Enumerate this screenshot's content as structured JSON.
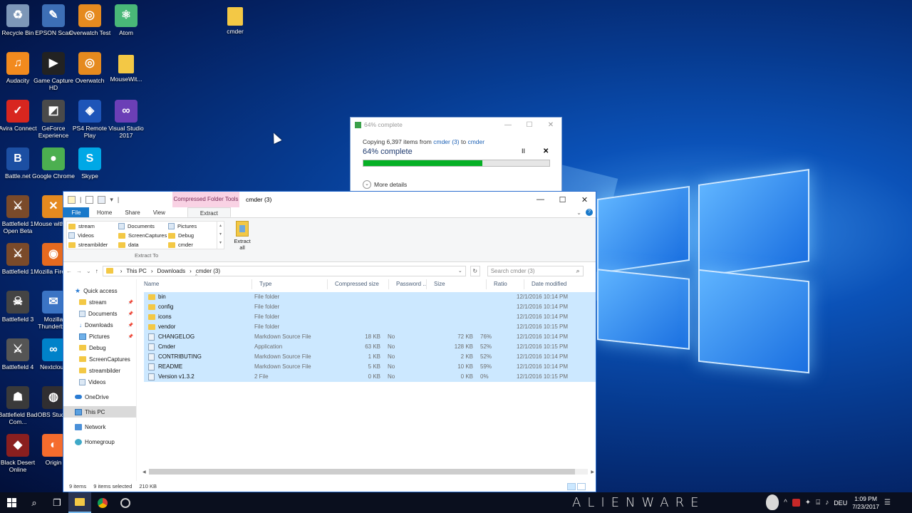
{
  "desktop": {
    "icons": [
      {
        "label": "Recycle Bin",
        "icon": "recycle-bin-icon",
        "color": "#7d97b8",
        "glyph": "♻"
      },
      {
        "label": "EPSON Scan",
        "icon": "scanner-icon",
        "color": "#3d6fb6",
        "glyph": "✎"
      },
      {
        "label": "Overwatch Test",
        "icon": "overwatch-icon",
        "color": "#e58a1f",
        "glyph": "◎"
      },
      {
        "label": "Atom",
        "icon": "atom-icon",
        "color": "#49b878",
        "glyph": "⚛"
      },
      {
        "label": "cmder",
        "icon": "folder-icon",
        "color": "#f3c845",
        "glyph": ""
      },
      {
        "label": "Audacity",
        "icon": "audacity-icon",
        "color": "#f28a1e",
        "glyph": "♫"
      },
      {
        "label": "Game Capture HD",
        "icon": "game-capture-icon",
        "color": "#222",
        "glyph": "▶"
      },
      {
        "label": "Overwatch",
        "icon": "overwatch-icon",
        "color": "#e58a1f",
        "glyph": "◎"
      },
      {
        "label": "MouseWit...",
        "icon": "folder-icon",
        "color": "#f3c845",
        "glyph": ""
      },
      {
        "label": "Avira Connect",
        "icon": "avira-icon",
        "color": "#d8261f",
        "glyph": "✓"
      },
      {
        "label": "GeForce Experience",
        "icon": "geforce-icon",
        "color": "#4a4a4a",
        "glyph": "◩"
      },
      {
        "label": "PS4 Remote Play",
        "icon": "ps4-icon",
        "color": "#1e55b8",
        "glyph": "◈"
      },
      {
        "label": "Visual Studio 2017",
        "icon": "visual-studio-icon",
        "color": "#6b3fb6",
        "glyph": "∞"
      },
      {
        "label": "Battle.net",
        "icon": "battlenet-icon",
        "color": "#1c4fa3",
        "glyph": "B"
      },
      {
        "label": "Google Chrome",
        "icon": "chrome-icon",
        "color": "#4caf50",
        "glyph": "●"
      },
      {
        "label": "Skype",
        "icon": "skype-icon",
        "color": "#00a8e6",
        "glyph": "S"
      },
      {
        "label": "Battlefield 1 Open Beta",
        "icon": "battlefield-icon",
        "color": "#7a4a2a",
        "glyph": "⚔"
      },
      {
        "label": "Mouse witho...",
        "icon": "mouse-icon",
        "color": "#e58a1f",
        "glyph": "✕"
      },
      {
        "label": "Battlefield 1",
        "icon": "battlefield-icon",
        "color": "#7a4a2a",
        "glyph": "⚔"
      },
      {
        "label": "Mozilla Firefox",
        "icon": "firefox-icon",
        "color": "#e66a1f",
        "glyph": "◉"
      },
      {
        "label": "Battlefield 3",
        "icon": "battlefield-icon",
        "color": "#444",
        "glyph": "☠"
      },
      {
        "label": "Mozilla Thunderb...",
        "icon": "thunderbird-icon",
        "color": "#3b74c4",
        "glyph": "✉"
      },
      {
        "label": "Battlefield 4",
        "icon": "battlefield-icon",
        "color": "#555",
        "glyph": "⚔"
      },
      {
        "label": "Nextcloud",
        "icon": "nextcloud-icon",
        "color": "#0082c9",
        "glyph": "∞"
      },
      {
        "label": "Battlefield Bad Com...",
        "icon": "battlefield-icon",
        "color": "#3a3a3a",
        "glyph": "☗"
      },
      {
        "label": "OBS Studio",
        "icon": "obs-icon",
        "color": "#302e31",
        "glyph": "◍"
      },
      {
        "label": "Black Desert Online",
        "icon": "black-desert-icon",
        "color": "#8a1f1f",
        "glyph": "◆"
      },
      {
        "label": "Origin",
        "icon": "origin-icon",
        "color": "#f56c2d",
        "glyph": "◐"
      }
    ]
  },
  "copy_dialog": {
    "title": "64% complete",
    "copying_prefix": "Copying 6,397 items from",
    "source": "cmder (3)",
    "to_word": "to",
    "destination": "cmder",
    "percent_text": "64% complete",
    "progress": 0.64,
    "pause_glyph": "II",
    "cancel_glyph": "✕",
    "more_details": "More details",
    "progress_color": "#06b025"
  },
  "explorer": {
    "title": "cmder (3)",
    "contextual_tab": "Compressed Folder Tools",
    "tabs": {
      "file": "File",
      "home": "Home",
      "share": "Share",
      "view": "View",
      "extract": "Extract"
    },
    "extract_grid": [
      {
        "label": "stream",
        "kind": "folder"
      },
      {
        "label": "Documents",
        "kind": "doc"
      },
      {
        "label": "Pictures",
        "kind": "doc"
      },
      {
        "label": "Videos",
        "kind": "doc"
      },
      {
        "label": "ScreenCaptures",
        "kind": "folder"
      },
      {
        "label": "Debug",
        "kind": "folder"
      },
      {
        "label": "streambilder",
        "kind": "folder"
      },
      {
        "label": "data",
        "kind": "folder"
      },
      {
        "label": "cmder",
        "kind": "folder"
      }
    ],
    "extract_to": "Extract To",
    "extract_all": "Extract all",
    "breadcrumb": [
      "This PC",
      "Downloads",
      "cmder (3)"
    ],
    "search_placeholder": "Search cmder (3)",
    "nav": {
      "quick_access": "Quick access",
      "pinned": [
        "stream",
        "Documents",
        "Downloads",
        "Pictures"
      ],
      "recent": [
        "Debug",
        "ScreenCaptures",
        "streambilder",
        "Videos"
      ],
      "onedrive": "OneDrive",
      "this_pc": "This PC",
      "network": "Network",
      "homegroup": "Homegroup"
    },
    "columns": {
      "name": "Name",
      "type": "Type",
      "csize": "Compressed size",
      "pw": "Password ...",
      "size": "Size",
      "ratio": "Ratio",
      "date": "Date modified"
    },
    "files": [
      {
        "name": "bin",
        "type": "File folder",
        "csize": "",
        "pw": "",
        "size": "",
        "ratio": "",
        "date": "12/1/2016 10:14 PM",
        "kind": "folder"
      },
      {
        "name": "config",
        "type": "File folder",
        "csize": "",
        "pw": "",
        "size": "",
        "ratio": "",
        "date": "12/1/2016 10:14 PM",
        "kind": "folder"
      },
      {
        "name": "icons",
        "type": "File folder",
        "csize": "",
        "pw": "",
        "size": "",
        "ratio": "",
        "date": "12/1/2016 10:14 PM",
        "kind": "folder"
      },
      {
        "name": "vendor",
        "type": "File folder",
        "csize": "",
        "pw": "",
        "size": "",
        "ratio": "",
        "date": "12/1/2016 10:15 PM",
        "kind": "folder"
      },
      {
        "name": "CHANGELOG",
        "type": "Markdown Source File",
        "csize": "18 KB",
        "pw": "No",
        "size": "72 KB",
        "ratio": "76%",
        "date": "12/1/2016 10:14 PM",
        "kind": "file"
      },
      {
        "name": "Cmder",
        "type": "Application",
        "csize": "63 KB",
        "pw": "No",
        "size": "128 KB",
        "ratio": "52%",
        "date": "12/1/2016 10:15 PM",
        "kind": "file"
      },
      {
        "name": "CONTRIBUTING",
        "type": "Markdown Source File",
        "csize": "1 KB",
        "pw": "No",
        "size": "2 KB",
        "ratio": "52%",
        "date": "12/1/2016 10:14 PM",
        "kind": "file"
      },
      {
        "name": "README",
        "type": "Markdown Source File",
        "csize": "5 KB",
        "pw": "No",
        "size": "10 KB",
        "ratio": "59%",
        "date": "12/1/2016 10:14 PM",
        "kind": "file"
      },
      {
        "name": "Version v1.3.2",
        "type": "2 File",
        "csize": "0 KB",
        "pw": "No",
        "size": "0 KB",
        "ratio": "0%",
        "date": "12/1/2016 10:15 PM",
        "kind": "file"
      }
    ],
    "status": {
      "items": "9 items",
      "selected": "9 items selected",
      "size": "210 KB"
    }
  },
  "taskbar": {
    "brand": "ALIENWARE",
    "lang": "DEU",
    "time": "1:09 PM",
    "date": "7/23/2017"
  }
}
